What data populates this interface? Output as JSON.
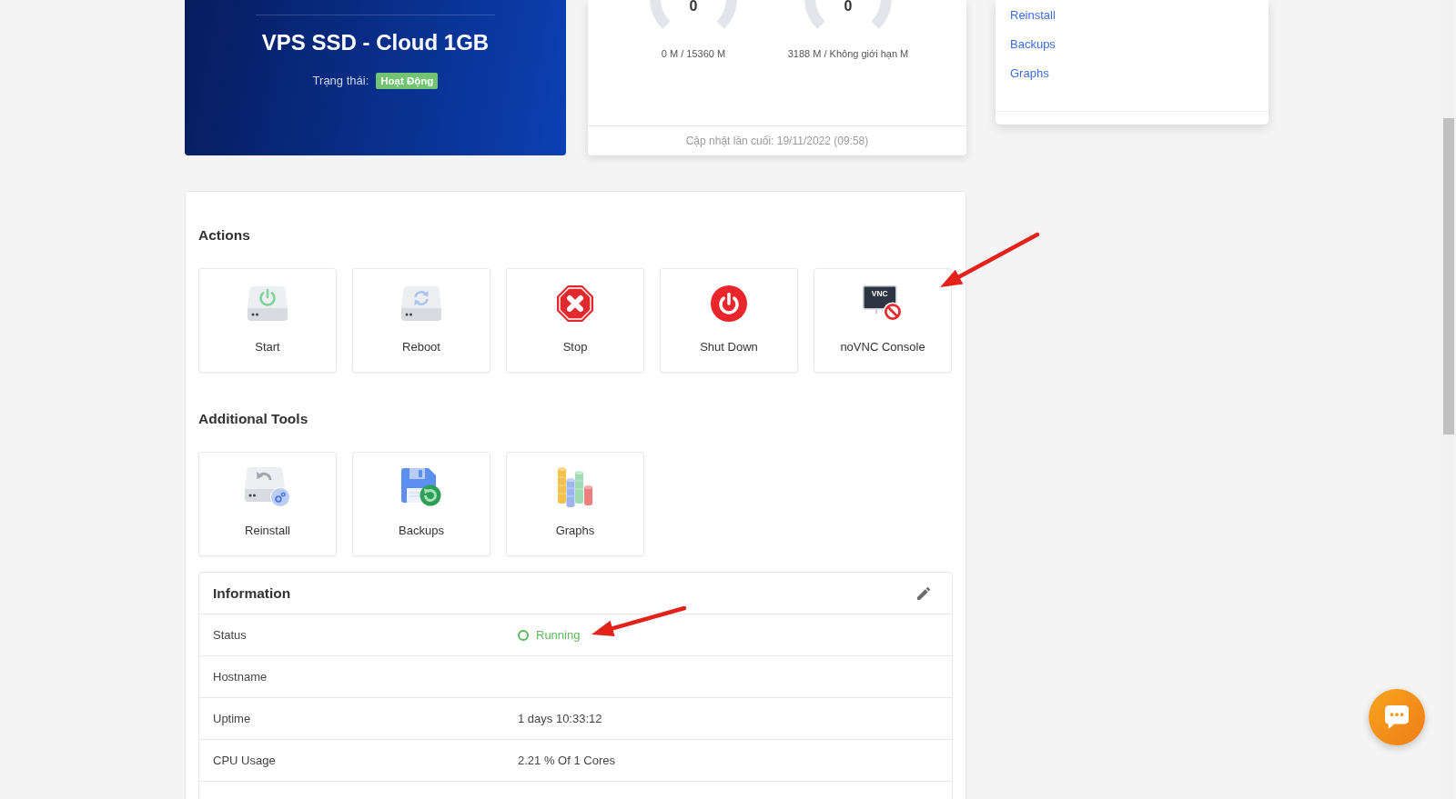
{
  "product_card": {
    "title": "VPS SSD - Cloud 1GB",
    "status_label": "Trạng thái:",
    "status_badge": "Hoạt Động"
  },
  "usage_card": {
    "gauges": [
      {
        "value": "0",
        "caption": "0 M / 15360 M"
      },
      {
        "value": "0",
        "caption": "3188 M / Không giới hạn M"
      }
    ],
    "footer": "Cập nhật lần cuối: 19/11/2022 (09:58)"
  },
  "side_menu": {
    "items": [
      "Reinstall",
      "Backups",
      "Graphs"
    ]
  },
  "actions": {
    "title": "Actions",
    "items": [
      {
        "label": "Start",
        "kind": "start"
      },
      {
        "label": "Reboot",
        "kind": "reboot"
      },
      {
        "label": "Stop",
        "kind": "stop"
      },
      {
        "label": "Shut Down",
        "kind": "shutdown"
      },
      {
        "label": "noVNC Console",
        "kind": "vnc",
        "icon_text": "VNC"
      }
    ]
  },
  "additional_tools": {
    "title": "Additional Tools",
    "items": [
      {
        "label": "Reinstall",
        "kind": "reinstall"
      },
      {
        "label": "Backups",
        "kind": "backups"
      },
      {
        "label": "Graphs",
        "kind": "graphs"
      }
    ]
  },
  "information": {
    "title": "Information",
    "rows": [
      {
        "label": "Status",
        "value": "Running",
        "kind": "status"
      },
      {
        "label": "Hostname",
        "kind": "text"
      },
      {
        "label": "Uptime",
        "value": "1 days 10:33:12",
        "kind": "text"
      },
      {
        "label": "CPU Usage",
        "value": "2.21 % Of 1 Cores",
        "kind": "text"
      }
    ]
  }
}
